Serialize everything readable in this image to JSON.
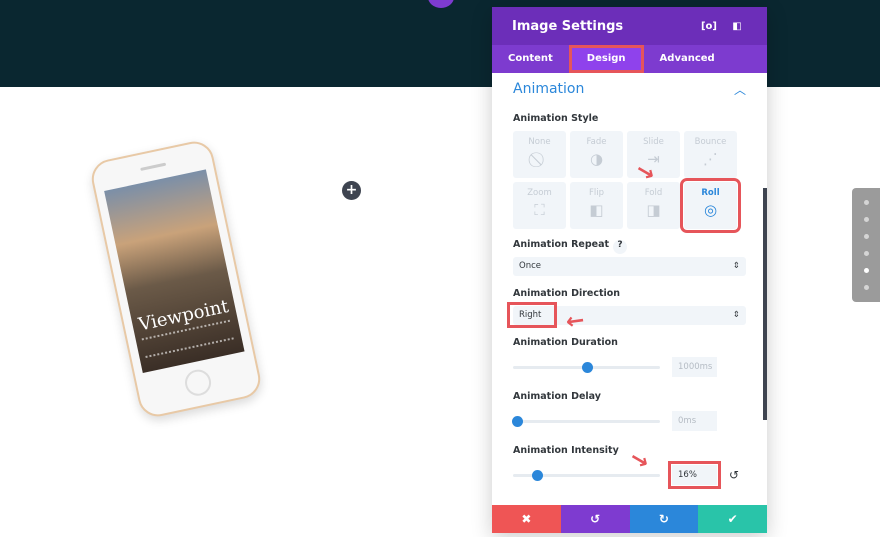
{
  "canvas": {
    "add_icon": "plus-icon",
    "phone_text": "Viewpoint"
  },
  "panel": {
    "title": "Image Settings",
    "header_icons": [
      "fullscreen-icon",
      "sidebar-toggle-icon"
    ],
    "tabs": [
      {
        "label": "Content"
      },
      {
        "label": "Design",
        "active": true
      },
      {
        "label": "Advanced"
      }
    ],
    "section": "Animation",
    "style_label": "Animation Style",
    "styles": [
      {
        "label": "None",
        "icon": "none-icon",
        "glyph": "⃠"
      },
      {
        "label": "Fade",
        "icon": "fade-icon",
        "glyph": "◑"
      },
      {
        "label": "Slide",
        "icon": "slide-icon",
        "glyph": "⇥"
      },
      {
        "label": "Bounce",
        "icon": "bounce-icon",
        "glyph": "⋰"
      },
      {
        "label": "Zoom",
        "icon": "zoom-icon",
        "glyph": "⛶"
      },
      {
        "label": "Flip",
        "icon": "flip-icon",
        "glyph": "◧"
      },
      {
        "label": "Fold",
        "icon": "fold-icon",
        "glyph": "◨"
      },
      {
        "label": "Roll",
        "icon": "roll-icon",
        "glyph": "◎",
        "selected": true
      }
    ],
    "repeat_label": "Animation Repeat",
    "help": "?",
    "repeat_value": "Once",
    "direction_label": "Animation Direction",
    "direction_value": "Right",
    "duration_label": "Animation Duration",
    "duration_value": "1000ms",
    "duration_pct": 50,
    "delay_label": "Animation Delay",
    "delay_value": "0ms",
    "delay_pct": 0,
    "intensity_label": "Animation Intensity",
    "intensity_value": "16%",
    "intensity_pct": 16,
    "footer": {
      "cancel": "✖",
      "undo": "↺",
      "redo": "↻",
      "save": "✔"
    },
    "colors": {
      "header": "#6c2eb9",
      "tabs": "#7d3bcf",
      "accent": "#2b87da",
      "cancel": "#ef5555",
      "undo": "#7e3bd0",
      "redo": "#2b87da",
      "save": "#29c4a9",
      "highlight": "#e6555a"
    }
  }
}
